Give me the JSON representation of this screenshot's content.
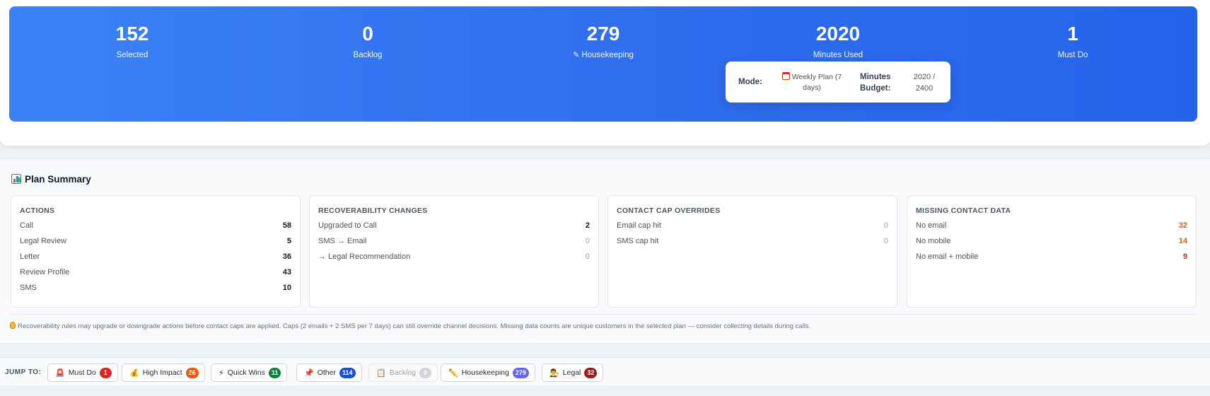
{
  "stats": [
    {
      "value": "152",
      "label": "Selected"
    },
    {
      "value": "0",
      "label": "Backlog"
    },
    {
      "value": "279",
      "label": "Housekeeping",
      "icon": "pencil-icon"
    },
    {
      "value": "2020",
      "label": "Minutes Used"
    },
    {
      "value": "1",
      "label": "Must Do"
    }
  ],
  "mode_popover": {
    "mode_label": "Mode:",
    "mode_value": "Weekly Plan (7 days)",
    "mode_icon": "calendar-icon",
    "budget_label": "Minutes Budget:",
    "budget_value": "2020 / 2400"
  },
  "summary": {
    "title": "Plan Summary",
    "title_icon": "bar-chart-icon",
    "panels": [
      {
        "title": "ACTIONS",
        "rows": [
          {
            "label": "Call",
            "value": "58"
          },
          {
            "label": "Legal Review",
            "value": "5"
          },
          {
            "label": "Letter",
            "value": "36"
          },
          {
            "label": "Review Profile",
            "value": "43"
          },
          {
            "label": "SMS",
            "value": "10"
          }
        ]
      },
      {
        "title": "RECOVERABILITY CHANGES",
        "rows": [
          {
            "label": "Upgraded to Call",
            "value": "2"
          },
          {
            "label": "SMS → Email",
            "value": "0"
          },
          {
            "label": "→ Legal Recommendation",
            "value": "0"
          }
        ]
      },
      {
        "title": "CONTACT CAP OVERRIDES",
        "rows": [
          {
            "label": "Email cap hit",
            "value": "0"
          },
          {
            "label": "SMS cap hit",
            "value": "0"
          }
        ]
      },
      {
        "title": "MISSING CONTACT DATA",
        "rows": [
          {
            "label": "No email",
            "value": "32"
          },
          {
            "label": "No mobile",
            "value": "14"
          },
          {
            "label": "No email + mobile",
            "value": "9"
          }
        ]
      }
    ],
    "note": "Recoverability rules may upgrade or downgrade actions before contact caps are applied. Caps (2 emails + 2 SMS per 7 days) can still override channel decisions. Missing data counts are unique customers in the selected plan — consider collecting details during calls.",
    "note_icon": "lightbulb-icon"
  },
  "jump": {
    "label": "JUMP TO:",
    "chips": [
      {
        "label": "Must Do",
        "count": "1",
        "icon": "siren-icon",
        "color": "#dc2626"
      },
      {
        "label": "High Impact",
        "count": "26",
        "icon": "money-bag-icon",
        "color": "#ea580c"
      },
      {
        "label": "Quick Wins",
        "count": "11",
        "icon": "lightning-icon",
        "color": "#15803d"
      },
      {
        "label": "Other",
        "count": "114",
        "icon": "pin-icon",
        "color": "#1d4ed8"
      },
      {
        "label": "Backlog",
        "count": "0",
        "icon": "clipboard-icon",
        "color": "#d1d5db"
      },
      {
        "label": "Housekeeping",
        "count": "279",
        "icon": "pencil-icon",
        "color": "#6366f1"
      },
      {
        "label": "Legal",
        "count": "32",
        "icon": "judge-icon",
        "color": "#991b1b"
      }
    ]
  }
}
